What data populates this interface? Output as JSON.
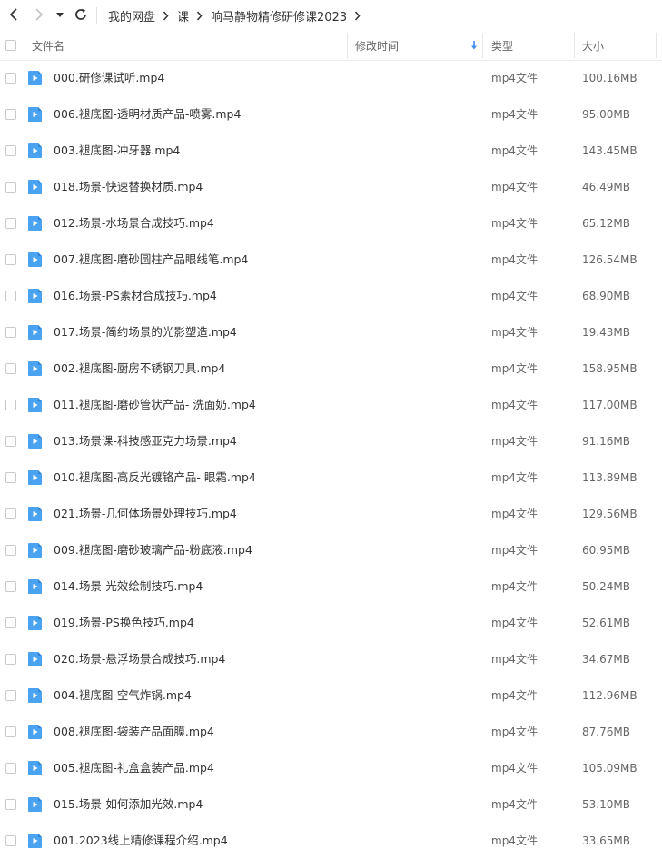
{
  "toolbar": {
    "back_icon": "chevron-left-icon",
    "forward_icon": "chevron-right-icon",
    "history_dropdown_icon": "caret-down-icon",
    "refresh_icon": "refresh-icon"
  },
  "breadcrumb": [
    {
      "label": "我的网盘"
    },
    {
      "label": "课"
    },
    {
      "label": "响马静物精修研修课2023"
    }
  ],
  "columns": {
    "name": "文件名",
    "modified": "修改时间",
    "type": "类型",
    "size": "大小",
    "sort_icon": "sort-down-arrow-icon",
    "sort_color": "#3b8cf0"
  },
  "colors": {
    "file_icon": "#4aa3f0",
    "accent": "#3b8cf0"
  },
  "files": [
    {
      "name": "000.研修课试听.mp4",
      "type": "mp4文件",
      "size": "100.16MB"
    },
    {
      "name": "006.褪底图-透明材质产品-喷雾.mp4",
      "type": "mp4文件",
      "size": "95.00MB"
    },
    {
      "name": "003.褪底图-冲牙器.mp4",
      "type": "mp4文件",
      "size": "143.45MB"
    },
    {
      "name": "018.场景-快速替换材质.mp4",
      "type": "mp4文件",
      "size": "46.49MB"
    },
    {
      "name": "012.场景-水场景合成技巧.mp4",
      "type": "mp4文件",
      "size": "65.12MB"
    },
    {
      "name": "007.褪底图-磨砂圆柱产品眼线笔.mp4",
      "type": "mp4文件",
      "size": "126.54MB"
    },
    {
      "name": "016.场景-PS素材合成技巧.mp4",
      "type": "mp4文件",
      "size": "68.90MB"
    },
    {
      "name": "017.场景-简约场景的光影塑造.mp4",
      "type": "mp4文件",
      "size": "19.43MB"
    },
    {
      "name": "002.褪底图-厨房不锈钢刀具.mp4",
      "type": "mp4文件",
      "size": "158.95MB"
    },
    {
      "name": "011.褪底图-磨砂管状产品- 洗面奶.mp4",
      "type": "mp4文件",
      "size": "117.00MB"
    },
    {
      "name": "013.场景课-科技感亚克力场景.mp4",
      "type": "mp4文件",
      "size": "91.16MB"
    },
    {
      "name": "010.褪底图-高反光镀铬产品- 眼霜.mp4",
      "type": "mp4文件",
      "size": "113.89MB"
    },
    {
      "name": "021.场景-几何体场景处理技巧.mp4",
      "type": "mp4文件",
      "size": "129.56MB"
    },
    {
      "name": "009.褪底图-磨砂玻璃产品-粉底液.mp4",
      "type": "mp4文件",
      "size": "60.95MB"
    },
    {
      "name": "014.场景-光效绘制技巧.mp4",
      "type": "mp4文件",
      "size": "50.24MB"
    },
    {
      "name": "019.场景-PS换色技巧.mp4",
      "type": "mp4文件",
      "size": "52.61MB"
    },
    {
      "name": "020.场景-悬浮场景合成技巧.mp4",
      "type": "mp4文件",
      "size": "34.67MB"
    },
    {
      "name": "004.褪底图-空气炸锅.mp4",
      "type": "mp4文件",
      "size": "112.96MB"
    },
    {
      "name": "008.褪底图-袋装产品面膜.mp4",
      "type": "mp4文件",
      "size": "87.76MB"
    },
    {
      "name": "005.褪底图-礼盒盒装产品.mp4",
      "type": "mp4文件",
      "size": "105.09MB"
    },
    {
      "name": "015.场景-如何添加光效.mp4",
      "type": "mp4文件",
      "size": "53.10MB"
    },
    {
      "name": "001.2023线上精修课程介绍.mp4",
      "type": "mp4文件",
      "size": "33.65MB"
    }
  ]
}
